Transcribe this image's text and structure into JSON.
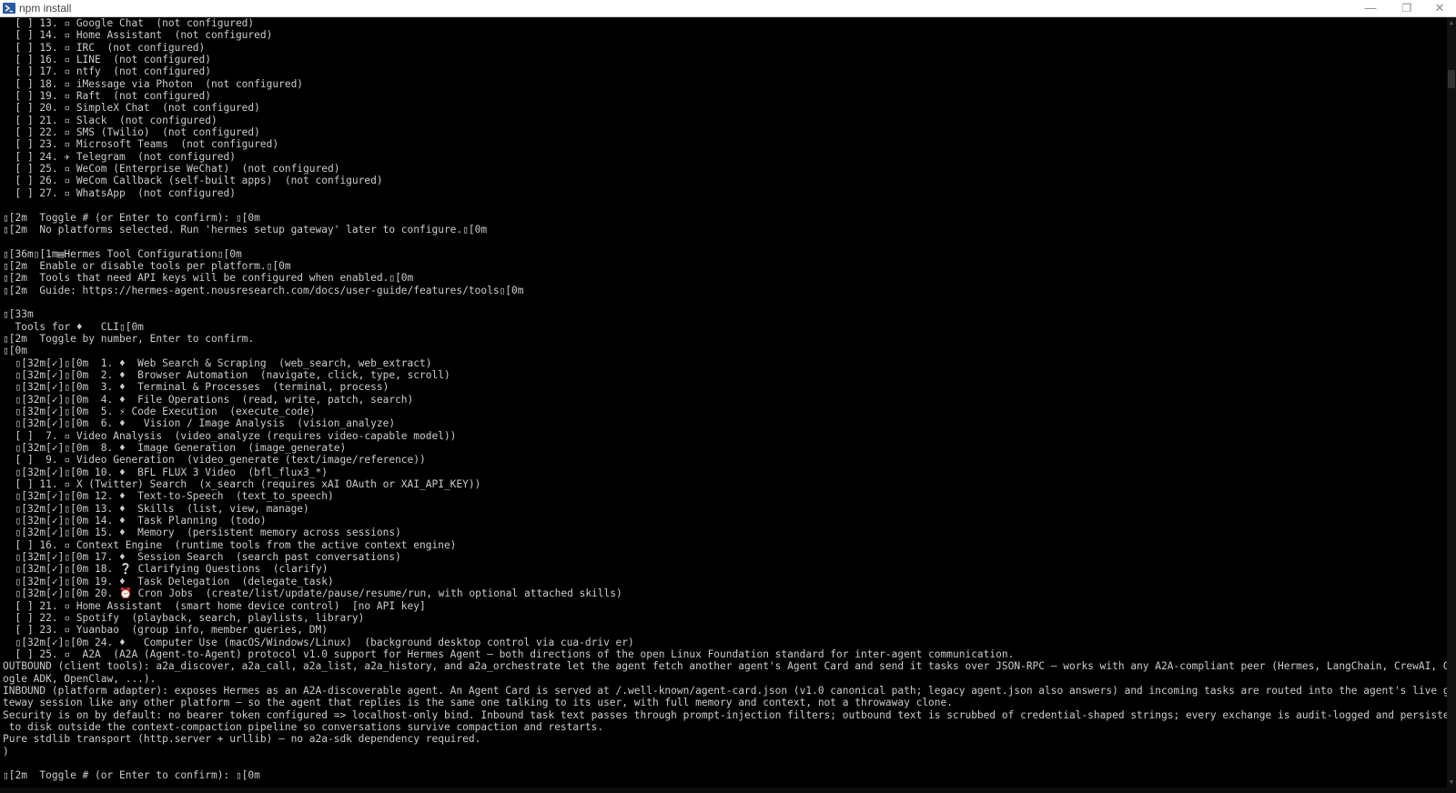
{
  "window": {
    "title": "npm install",
    "minimize_glyph": "—",
    "maximize_glyph": "❐",
    "close_glyph": "✕"
  },
  "terminal": {
    "lines": [
      "  [ ] 13. ▫ Google Chat  (not configured)",
      "  [ ] 14. ▫ Home Assistant  (not configured)",
      "  [ ] 15. ▫ IRC  (not configured)",
      "  [ ] 16. ▫ LINE  (not configured)",
      "  [ ] 17. ▫ ntfy  (not configured)",
      "  [ ] 18. ▫ iMessage via Photon  (not configured)",
      "  [ ] 19. ▫ Raft  (not configured)",
      "  [ ] 20. ▫ SimpleX Chat  (not configured)",
      "  [ ] 21. ▫ Slack  (not configured)",
      "  [ ] 22. ▫ SMS (Twilio)  (not configured)",
      "  [ ] 23. ▫ Microsoft Teams  (not configured)",
      "  [ ] 24. ✈ Telegram  (not configured)",
      "  [ ] 25. ▫ WeCom (Enterprise WeChat)  (not configured)",
      "  [ ] 26. ▫ WeCom Callback (self-built apps)  (not configured)",
      "  [ ] 27. ▫ WhatsApp  (not configured)",
      "",
      "▯[2m  Toggle # (or Enter to confirm): ▯[0m",
      "▯[2m  No platforms selected. Run 'hermes setup gateway' later to configure.▯[0m",
      "",
      "▯[36m▯[1m▤Hermes Tool Configuration▯[0m",
      "▯[2m  Enable or disable tools per platform.▯[0m",
      "▯[2m  Tools that need API keys will be configured when enabled.▯[0m",
      "▯[2m  Guide: https://hermes-agent.nousresearch.com/docs/user-guide/features/tools▯[0m",
      "",
      "▯[33m",
      "  Tools for ♦   CLI▯[0m",
      "▯[2m  Toggle by number, Enter to confirm.",
      "▯[0m",
      "  ▯[32m[✓]▯[0m  1. ♦  Web Search & Scraping  (web_search, web_extract)",
      "  ▯[32m[✓]▯[0m  2. ♦  Browser Automation  (navigate, click, type, scroll)",
      "  ▯[32m[✓]▯[0m  3. ♦  Terminal & Processes  (terminal, process)",
      "  ▯[32m[✓]▯[0m  4. ♦  File Operations  (read, write, patch, search)",
      "  ▯[32m[✓]▯[0m  5. ⚡ Code Execution  (execute_code)",
      "  ▯[32m[✓]▯[0m  6. ♦   Vision / Image Analysis  (vision_analyze)",
      "  [ ]  7. ▫ Video Analysis  (video_analyze (requires video-capable model))",
      "  ▯[32m[✓]▯[0m  8. ♦  Image Generation  (image_generate)",
      "  [ ]  9. ▫ Video Generation  (video_generate (text/image/reference))",
      "  ▯[32m[✓]▯[0m 10. ♦  BFL FLUX 3 Video  (bfl_flux3_*)",
      "  [ ] 11. ▫ X (Twitter) Search  (x_search (requires xAI OAuth or XAI_API_KEY))",
      "  ▯[32m[✓]▯[0m 12. ♦  Text-to-Speech  (text_to_speech)",
      "  ▯[32m[✓]▯[0m 13. ♦  Skills  (list, view, manage)",
      "  ▯[32m[✓]▯[0m 14. ♦  Task Planning  (todo)",
      "  ▯[32m[✓]▯[0m 15. ♦  Memory  (persistent memory across sessions)",
      "  [ ] 16. ▫ Context Engine  (runtime tools from the active context engine)",
      "  ▯[32m[✓]▯[0m 17. ♦  Session Search  (search past conversations)",
      "  ▯[32m[✓]▯[0m 18. ❔ Clarifying Questions  (clarify)",
      "  ▯[32m[✓]▯[0m 19. ♦  Task Delegation  (delegate_task)",
      "  ▯[32m[✓]▯[0m 20. ⏰ Cron Jobs  (create/list/update/pause/resume/run, with optional attached skills)",
      "  [ ] 21. ▫ Home Assistant  (smart home device control)  [no API key]",
      "  [ ] 22. ▫ Spotify  (playback, search, playlists, library)",
      "  [ ] 23. ▫ Yuanbao  (group info, member queries, DM)",
      "  ▯[32m[✓]▯[0m 24. ♦   Computer Use (macOS/Windows/Linux)  (background desktop control via cua-driv er)",
      "  [ ] 25. ▫  A2A  (A2A (Agent-to-Agent) protocol v1.0 support for Hermes Agent — both directions of the open Linux Foundation standard for inter-agent communication.",
      "OUTBOUND (client tools): a2a_discover, a2a_call, a2a_list, a2a_history, and a2a_orchestrate let the agent fetch another agent's Agent Card and send it tasks over JSON-RPC — works with any A2A-compliant peer (Hermes, LangChain, CrewAI, Go",
      "ogle ADK, OpenClaw, ...).",
      "INBOUND (platform adapter): exposes Hermes as an A2A-discoverable agent. An Agent Card is served at /.well-known/agent-card.json (v1.0 canonical path; legacy agent.json also answers) and incoming tasks are routed into the agent's live ga",
      "teway session like any other platform — so the agent that replies is the same one talking to its user, with full memory and context, not a throwaway clone.",
      "Security is on by default: no bearer token configured => localhost-only bind. Inbound task text passes through prompt-injection filters; outbound text is scrubbed of credential-shaped strings; every exchange is audit-logged and persisted",
      " to disk outside the context-compaction pipeline so conversations survive compaction and restarts.",
      "Pure stdlib transport (http.server + urllib) — no a2a-sdk dependency required.",
      ")",
      "",
      "▯[2m  Toggle # (or Enter to confirm): ▯[0m"
    ]
  }
}
